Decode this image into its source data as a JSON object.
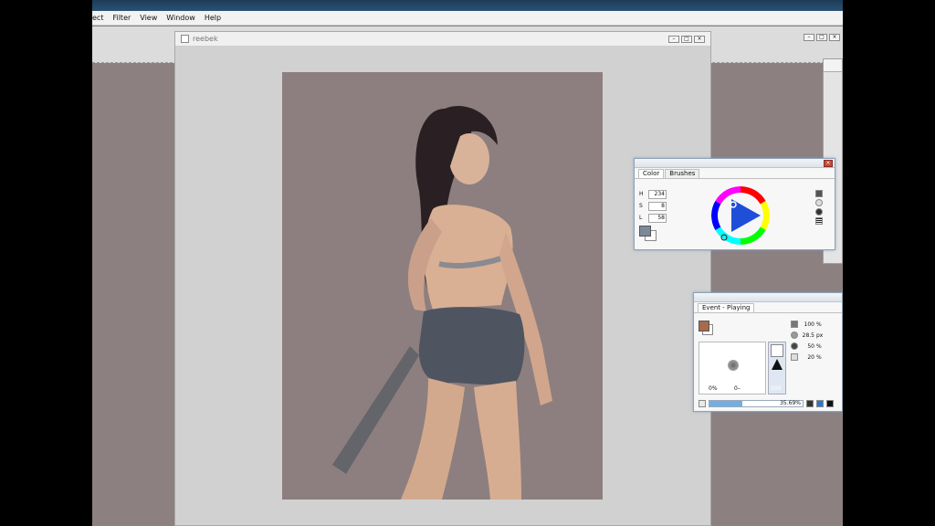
{
  "menu": [
    "ect",
    "Filter",
    "View",
    "Window",
    "Help"
  ],
  "document": {
    "name": "reebek"
  },
  "color_panel": {
    "tabs": [
      "Color",
      "Brushes"
    ],
    "fields": [
      {
        "label": "H",
        "value": "234"
      },
      {
        "label": "S",
        "value": "8"
      },
      {
        "label": "L",
        "value": "58"
      }
    ],
    "current_color": "#7c8999"
  },
  "brush_panel": {
    "tab": "Event - Playing",
    "current_color": "#a86a4a",
    "opacity_left": "0%",
    "size_left": "0–",
    "flow": "100",
    "rows": [
      {
        "value": "100",
        "unit": "%"
      },
      {
        "value": "28.5",
        "unit": "px"
      },
      {
        "value": "50",
        "unit": "%"
      },
      {
        "value": "20",
        "unit": "%"
      }
    ],
    "progress_label": "35.69%",
    "progress": 0.3569
  },
  "colors": {
    "canvas_bg": "#8d7f7f",
    "workspace_bg": "#8c8080",
    "accent": "#3b83c8"
  }
}
